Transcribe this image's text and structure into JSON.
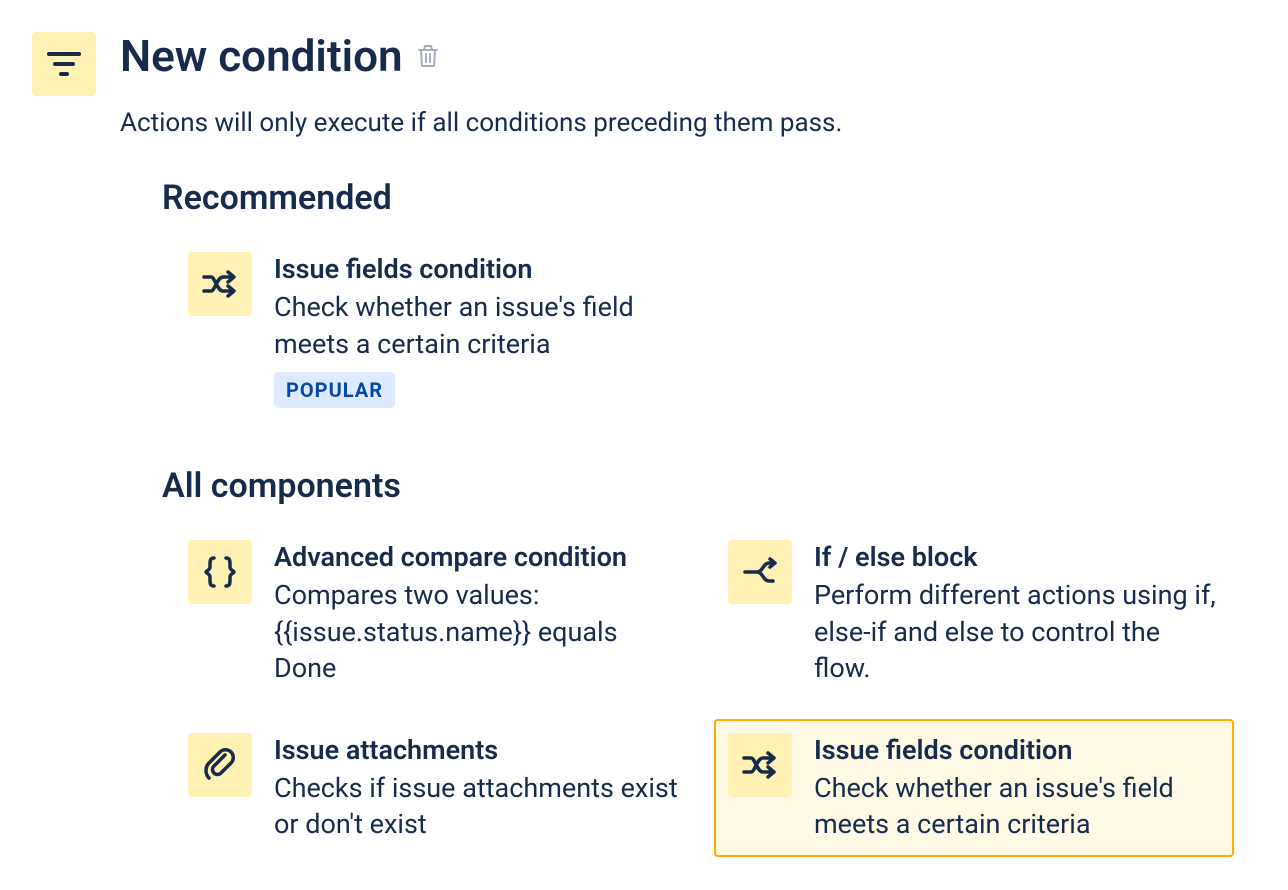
{
  "header": {
    "title": "New condition",
    "subtitle": "Actions will only execute if all conditions preceding them pass."
  },
  "sections": {
    "recommended": {
      "heading": "Recommended",
      "items": [
        {
          "title": "Issue fields condition",
          "desc": "Check whether an issue's field meets a certain criteria",
          "badge": "POPULAR",
          "icon": "shuffle-icon"
        }
      ]
    },
    "all": {
      "heading": "All components",
      "items": [
        {
          "title": "Advanced compare condition",
          "desc": "Compares two values: {{issue.status.name}} equals Done",
          "icon": "braces-icon"
        },
        {
          "title": "If / else block",
          "desc": "Perform different actions using if, else-if and else to control the flow.",
          "icon": "branch-icon"
        },
        {
          "title": "Issue attachments",
          "desc": "Checks if issue attachments exist or don't exist",
          "icon": "attachment-icon"
        },
        {
          "title": "Issue fields condition",
          "desc": "Check whether an issue's field meets a certain criteria",
          "icon": "shuffle-icon",
          "highlight": true
        }
      ]
    }
  }
}
